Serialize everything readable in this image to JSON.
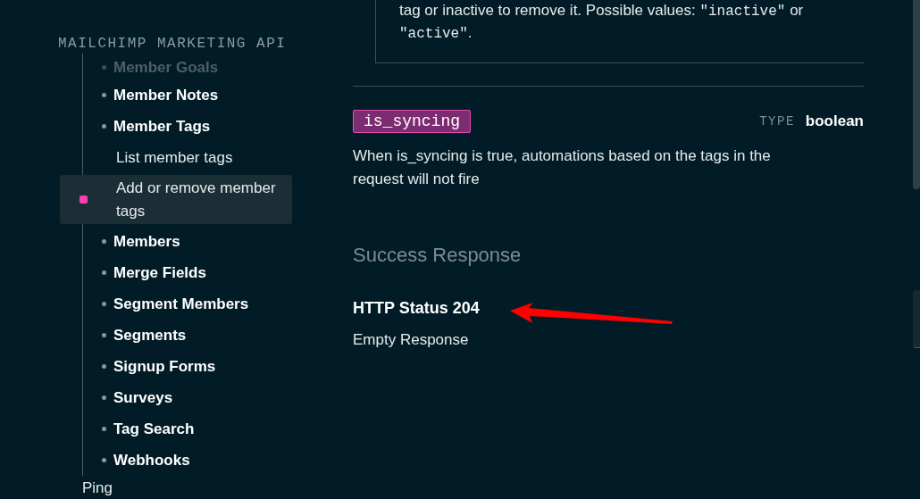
{
  "sidebar": {
    "title": "MAILCHIMP MARKETING API",
    "items": [
      {
        "label": "Member Goals",
        "faded": true
      },
      {
        "label": "Member Notes",
        "faded": false
      },
      {
        "label": "Member Tags",
        "faded": false,
        "children": [
          {
            "label": "List member tags",
            "selected": false
          },
          {
            "label": "Add or remove member tags",
            "selected": true
          }
        ]
      },
      {
        "label": "Members",
        "faded": false
      },
      {
        "label": "Merge Fields",
        "faded": false
      },
      {
        "label": "Segment Members",
        "faded": false
      },
      {
        "label": "Segments",
        "faded": false
      },
      {
        "label": "Signup Forms",
        "faded": false
      },
      {
        "label": "Surveys",
        "faded": false
      },
      {
        "label": "Tag Search",
        "faded": false
      },
      {
        "label": "Webhooks",
        "faded": false
      }
    ],
    "next_item": "Ping"
  },
  "main": {
    "previous_parameter": {
      "description": [
        {
          "kind": "plain",
          "text": "tag or inactive to remove it. Possible values: "
        },
        {
          "kind": "code",
          "text": "\"inactive\""
        },
        {
          "kind": "plain",
          "text": " or "
        },
        {
          "kind": "code",
          "text": "\"active\""
        },
        {
          "kind": "plain",
          "text": "."
        }
      ]
    },
    "parameter": {
      "name": "is_syncing",
      "type_label": "TYPE",
      "type": "boolean",
      "description": "When is_syncing is true, automations based on the tags in the request will not fire"
    },
    "success_response": {
      "heading": "Success Response",
      "status": "HTTP Status 204",
      "body": "Empty Response"
    }
  }
}
